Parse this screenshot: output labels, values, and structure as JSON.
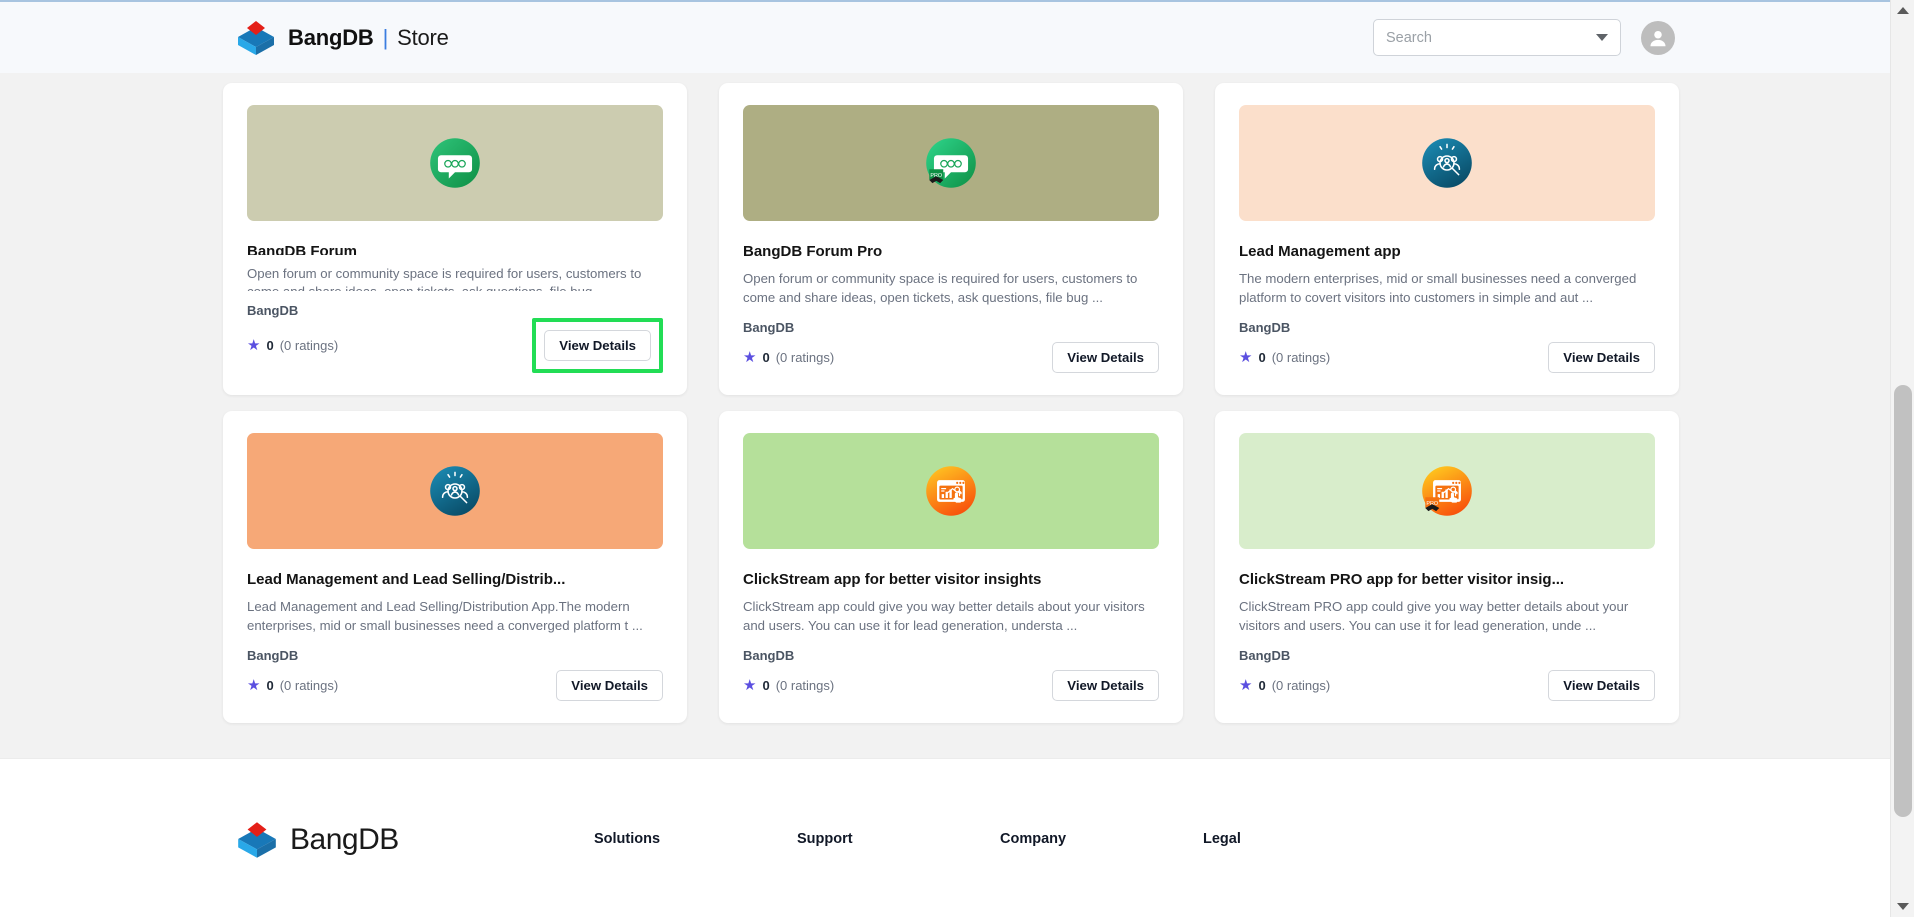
{
  "header": {
    "brand_name": "BangDB",
    "brand_separator": "|",
    "brand_section": "Store",
    "logo_icon": "bangdb-logo-icon",
    "search": {
      "placeholder": "Search",
      "value": "",
      "dropdown_icon": "chevron-down-icon"
    },
    "avatar_icon": "user-avatar-icon"
  },
  "cards": [
    {
      "title": "BangDB Forum",
      "description": "Open forum or community space is required for users, customers to come and share ideas, open tickets, ask questions, file bug ...",
      "vendor": "BangDB",
      "rating_value": "0",
      "rating_count": "(0 ratings)",
      "button_label": "View Details",
      "highlighted": true,
      "image_bg": "#ccccb0",
      "icon_name": "forum-chat-bubble-icon",
      "icon_style": "forum",
      "pro": false
    },
    {
      "title": "BangDB Forum Pro",
      "description": "Open forum or community space is required for users, customers to come and share ideas, open tickets, ask questions, file bug ...",
      "vendor": "BangDB",
      "rating_value": "0",
      "rating_count": "(0 ratings)",
      "button_label": "View Details",
      "highlighted": false,
      "image_bg": "#aeae83",
      "icon_name": "forum-chat-bubble-pro-icon",
      "icon_style": "forum",
      "pro": true,
      "pro_label": "PRO"
    },
    {
      "title": "Lead Management app",
      "description": "The modern enterprises, mid or small businesses need a converged platform to covert visitors into customers in simple and aut ...",
      "vendor": "BangDB",
      "rating_value": "0",
      "rating_count": "(0 ratings)",
      "button_label": "View Details",
      "highlighted": false,
      "image_bg": "#fbdfcb",
      "icon_name": "lead-search-people-icon",
      "icon_style": "lead",
      "pro": false
    },
    {
      "title": "Lead Management and Lead Selling/Distrib...",
      "description": "Lead Management and Lead Selling/Distribution App.The modern enterprises, mid or small businesses need a converged platform t ...",
      "vendor": "BangDB",
      "rating_value": "0",
      "rating_count": "(0 ratings)",
      "button_label": "View Details",
      "highlighted": false,
      "image_bg": "#f6a877",
      "icon_name": "lead-search-people-icon",
      "icon_style": "lead",
      "pro": false
    },
    {
      "title": "ClickStream app for better visitor insights",
      "description": "ClickStream app could give you way better details about your visitors and users. You can use it for lead generation, understa ...",
      "vendor": "BangDB",
      "rating_value": "0",
      "rating_count": "(0 ratings)",
      "button_label": "View Details",
      "highlighted": false,
      "image_bg": "#b5e09a",
      "icon_name": "clickstream-analytics-icon",
      "icon_style": "clickstream",
      "pro": false
    },
    {
      "title": "ClickStream PRO app for better visitor insig...",
      "description": "ClickStream PRO app could give you way better details about your visitors and users. You can use it for lead generation, unde ...",
      "vendor": "BangDB",
      "rating_value": "0",
      "rating_count": "(0 ratings)",
      "button_label": "View Details",
      "highlighted": false,
      "image_bg": "#d8edcb",
      "icon_name": "clickstream-analytics-pro-icon",
      "icon_style": "clickstream",
      "pro": true,
      "pro_label": "PRO"
    }
  ],
  "footer": {
    "brand_name": "BangDB",
    "logo_icon": "bangdb-logo-icon",
    "columns": [
      {
        "title": "Solutions"
      },
      {
        "title": "Support"
      },
      {
        "title": "Company"
      },
      {
        "title": "Legal"
      }
    ]
  },
  "colors": {
    "accent_highlight": "#22dd55",
    "star": "#5b4fe0",
    "brand_blue": "#3b7de0",
    "page_bg": "#f2f2f2",
    "header_bg": "#f7f9fc"
  }
}
